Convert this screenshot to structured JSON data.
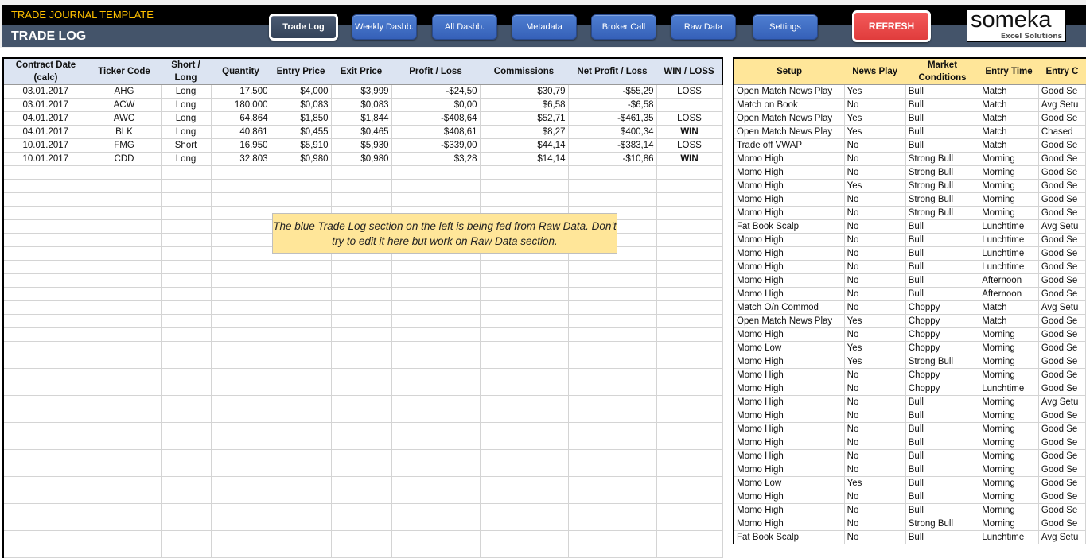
{
  "header": {
    "app_title": "TRADE JOURNAL TEMPLATE",
    "page_title": "TRADE LOG",
    "nav": [
      {
        "label": "Trade Log",
        "active": true
      },
      {
        "label": "Weekly Dashb.",
        "active": false
      },
      {
        "label": "All Dashb.",
        "active": false
      },
      {
        "label": "Metadata",
        "active": false
      },
      {
        "label": "Broker Call",
        "active": false
      },
      {
        "label": "Raw Data",
        "active": false
      },
      {
        "label": "Settings",
        "active": false
      }
    ],
    "refresh_label": "REFRESH",
    "logo": {
      "word": "someka",
      "sub": "Excel Solutions"
    }
  },
  "colors": {
    "banner_top": "#000000",
    "banner_bottom": "#44546a",
    "title_accent": "#ffc000",
    "nav_button": "#4472c4",
    "refresh_button": "#f04a4a",
    "left_header": "#dce4f2",
    "right_header": "#ffe699",
    "negative": "#ff0000",
    "win": "#00b050"
  },
  "note": "The blue Trade Log section on the left is being fed from Raw Data. Don't try to edit it here but work on Raw Data section.",
  "trade_log": {
    "columns": [
      "Contract Date (calc)",
      "Ticker Code",
      "Short / Long",
      "Quantity",
      "Entry Price",
      "Exit Price",
      "Profit / Loss",
      "Commissions",
      "Net Profit / Loss",
      "WIN / LOSS"
    ],
    "rows": [
      [
        "03.01.2017",
        "AHG",
        "Long",
        "17.500",
        "$4,000",
        "$3,999",
        "-$24,50",
        "$30,79",
        "-$55,29",
        "LOSS"
      ],
      [
        "03.01.2017",
        "ACW",
        "Long",
        "180.000",
        "$0,083",
        "$0,083",
        "$0,00",
        "$6,58",
        "-$6,58",
        ""
      ],
      [
        "04.01.2017",
        "AWC",
        "Long",
        "64.864",
        "$1,850",
        "$1,844",
        "-$408,64",
        "$52,71",
        "-$461,35",
        "LOSS"
      ],
      [
        "04.01.2017",
        "BLK",
        "Long",
        "40.861",
        "$0,455",
        "$0,465",
        "$408,61",
        "$8,27",
        "$400,34",
        "WIN"
      ],
      [
        "10.01.2017",
        "FMG",
        "Short",
        "16.950",
        "$5,910",
        "$5,930",
        "-$339,00",
        "$44,14",
        "-$383,14",
        "LOSS"
      ],
      [
        "10.01.2017",
        "CDD",
        "Long",
        "32.803",
        "$0,980",
        "$0,980",
        "$3,28",
        "$14,14",
        "-$10,86",
        "WIN"
      ]
    ],
    "empty_rows": 29
  },
  "setup_table": {
    "columns": [
      "Setup",
      "News Play",
      "Market Conditions",
      "Entry Time",
      "Entry C"
    ],
    "rows": [
      [
        "Open Match News Play",
        "Yes",
        "Bull",
        "Match",
        "Good Se"
      ],
      [
        "Match on Book",
        "No",
        "Bull",
        "Match",
        "Avg Setu"
      ],
      [
        "Open Match News Play",
        "Yes",
        "Bull",
        "Match",
        "Good Se"
      ],
      [
        "Open Match News Play",
        "Yes",
        "Bull",
        "Match",
        "Chased"
      ],
      [
        "Trade off VWAP",
        "No",
        "Bull",
        "Match",
        "Good Se"
      ],
      [
        "Momo High",
        "No",
        "Strong Bull",
        "Morning",
        "Good Se"
      ],
      [
        "Momo High",
        "No",
        "Strong Bull",
        "Morning",
        "Good Se"
      ],
      [
        "Momo High",
        "Yes",
        "Strong Bull",
        "Morning",
        "Good Se"
      ],
      [
        "Momo High",
        "No",
        "Strong Bull",
        "Morning",
        "Good Se"
      ],
      [
        "Momo High",
        "No",
        "Strong Bull",
        "Morning",
        "Good Se"
      ],
      [
        "Fat Book Scalp",
        "No",
        "Bull",
        "Lunchtime",
        "Avg Setu"
      ],
      [
        "Momo High",
        "No",
        "Bull",
        "Lunchtime",
        "Good Se"
      ],
      [
        "Momo High",
        "No",
        "Bull",
        "Lunchtime",
        "Good Se"
      ],
      [
        "Momo High",
        "No",
        "Bull",
        "Lunchtime",
        "Good Se"
      ],
      [
        "Momo High",
        "No",
        "Bull",
        "Afternoon",
        "Good Se"
      ],
      [
        "Momo High",
        "No",
        "Bull",
        "Afternoon",
        "Good Se"
      ],
      [
        "Match O/n Commod",
        "No",
        "Choppy",
        "Match",
        "Avg Setu"
      ],
      [
        "Open Match News Play",
        "Yes",
        "Choppy",
        "Match",
        "Good Se"
      ],
      [
        "Momo High",
        "No",
        "Choppy",
        "Morning",
        "Good Se"
      ],
      [
        "Momo Low",
        "Yes",
        "Choppy",
        "Morning",
        "Good Se"
      ],
      [
        "Momo High",
        "Yes",
        "Strong Bull",
        "Morning",
        "Good Se"
      ],
      [
        "Momo High",
        "No",
        "Choppy",
        "Morning",
        "Good Se"
      ],
      [
        "Momo High",
        "No",
        "Choppy",
        "Lunchtime",
        "Good Se"
      ],
      [
        "Momo High",
        "No",
        "Bull",
        "Morning",
        "Avg Setu"
      ],
      [
        "Momo High",
        "No",
        "Bull",
        "Morning",
        "Good Se"
      ],
      [
        "Momo High",
        "No",
        "Bull",
        "Morning",
        "Good Se"
      ],
      [
        "Momo High",
        "No",
        "Bull",
        "Morning",
        "Good Se"
      ],
      [
        "Momo High",
        "No",
        "Bull",
        "Morning",
        "Good Se"
      ],
      [
        "Momo High",
        "No",
        "Bull",
        "Morning",
        "Good Se"
      ],
      [
        "Momo Low",
        "Yes",
        "Bull",
        "Morning",
        "Good Se"
      ],
      [
        "Momo High",
        "No",
        "Bull",
        "Morning",
        "Good Se"
      ],
      [
        "Momo High",
        "No",
        "Bull",
        "Morning",
        "Good Se"
      ],
      [
        "Momo High",
        "No",
        "Strong Bull",
        "Morning",
        "Good Se"
      ],
      [
        "Fat Book Scalp",
        "No",
        "Bull",
        "Lunchtime",
        "Avg Setu"
      ]
    ]
  }
}
